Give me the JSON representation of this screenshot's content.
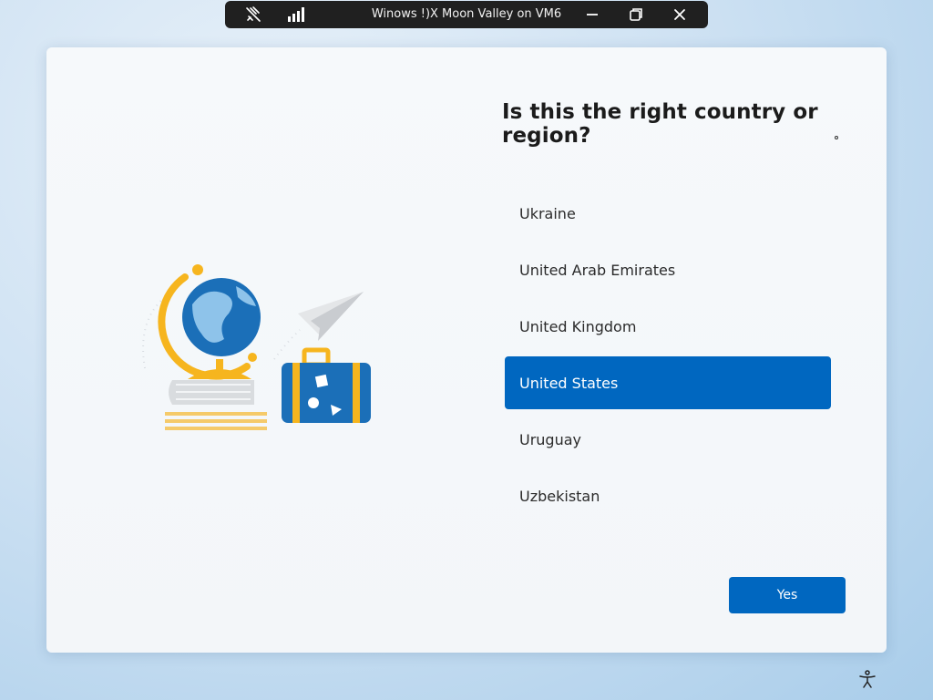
{
  "rdp_bar": {
    "title": "Winows !)X Moon Valley on VM6",
    "icons": [
      "unpin-icon",
      "signal-bars-icon",
      "minimize-icon",
      "restore-icon",
      "close-icon"
    ]
  },
  "oobe": {
    "heading": "Is this the right country or region?",
    "countries": [
      "Ukraine",
      "United Arab Emirates",
      "United Kingdom",
      "United States",
      "Uruguay",
      "Uzbekistan"
    ],
    "selected": "United States",
    "yes_label": "Yes"
  },
  "colors": {
    "accent": "#0067c0",
    "toolbar": "#202020",
    "globe_stand": "#f6b51e",
    "globe_ocean": "#1b6fb8"
  },
  "icons": [
    "globe-illustration",
    "paper-plane-illustration",
    "suitcase-illustration",
    "accessibility-icon"
  ]
}
